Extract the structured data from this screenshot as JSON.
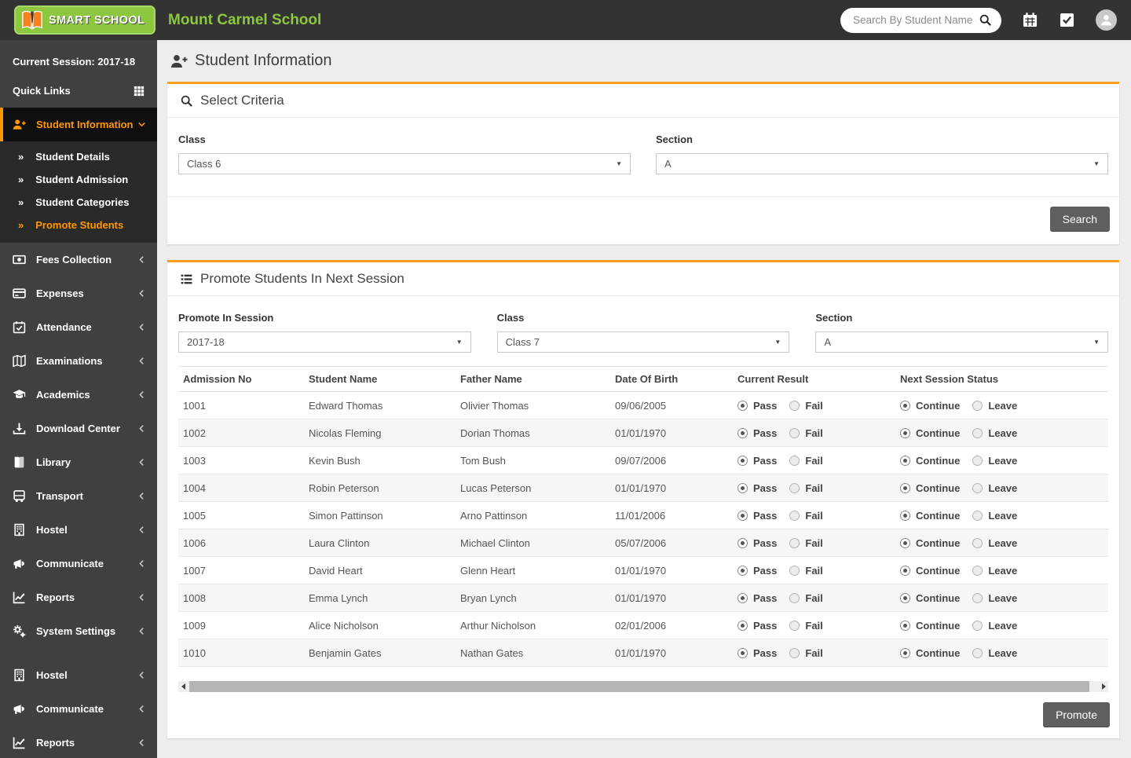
{
  "colors": {
    "accent": "#f9a11b",
    "active_orange": "#ff9800",
    "brand_green": "#8dc63f",
    "button_gray": "#5f5f5f",
    "header_bg": "#333333",
    "sidebar_bg": "#404040"
  },
  "header": {
    "brand": "SMART SCHOOL",
    "school_name": "Mount Carmel School",
    "search_placeholder": "Search By Student Name",
    "icons": [
      "search-icon",
      "calendar-icon",
      "tasks-icon",
      "user-avatar"
    ]
  },
  "sidebar": {
    "session_label": "Current Session: 2017-18",
    "quick_links_label": "Quick Links",
    "quick_links_icon": "grid",
    "active_group": {
      "label": "Student Information",
      "icon": "person-plus",
      "children": [
        {
          "label": "Student Details"
        },
        {
          "label": "Student Admission"
        },
        {
          "label": "Student Categories"
        },
        {
          "label": "Promote Students",
          "active": true
        }
      ]
    },
    "items": [
      {
        "label": "Fees Collection",
        "icon": "money"
      },
      {
        "label": "Expenses",
        "icon": "credit-card"
      },
      {
        "label": "Attendance",
        "icon": "calendar-check"
      },
      {
        "label": "Examinations",
        "icon": "map"
      },
      {
        "label": "Academics",
        "icon": "graduation-cap"
      },
      {
        "label": "Download Center",
        "icon": "download"
      },
      {
        "label": "Library",
        "icon": "book"
      },
      {
        "label": "Transport",
        "icon": "bus"
      },
      {
        "label": "Hostel",
        "icon": "building"
      },
      {
        "label": "Communicate",
        "icon": "megaphone"
      },
      {
        "label": "Reports",
        "icon": "chart"
      },
      {
        "label": "System Settings",
        "icon": "gears"
      },
      {
        "label": "Hostel",
        "icon": "building",
        "spacer_before": true
      },
      {
        "label": "Communicate",
        "icon": "megaphone"
      },
      {
        "label": "Reports",
        "icon": "chart"
      }
    ]
  },
  "page": {
    "title": "Student Information",
    "title_icon": "person-plus"
  },
  "select_criteria": {
    "title": "Select Criteria",
    "title_icon": "search",
    "fields": [
      {
        "label": "Class",
        "value": "Class 6"
      },
      {
        "label": "Section",
        "value": "A"
      }
    ],
    "search_button": "Search"
  },
  "promote_panel": {
    "title": "Promote Students In Next Session",
    "title_icon": "list",
    "fields": [
      {
        "label": "Promote In Session",
        "value": "2017-18"
      },
      {
        "label": "Class",
        "value": "Class 7"
      },
      {
        "label": "Section",
        "value": "A"
      }
    ],
    "table": {
      "columns": [
        "Admission No",
        "Student Name",
        "Father Name",
        "Date Of Birth",
        "Current Result",
        "Next Session Status"
      ],
      "result_options": [
        "Pass",
        "Fail"
      ],
      "status_options": [
        "Continue",
        "Leave"
      ],
      "rows": [
        {
          "admission_no": "1001",
          "student_name": "Edward Thomas",
          "father_name": "Olivier Thomas",
          "dob": "09/06/2005",
          "result": "Pass",
          "status": "Continue"
        },
        {
          "admission_no": "1002",
          "student_name": "Nicolas Fleming",
          "father_name": "Dorian Thomas",
          "dob": "01/01/1970",
          "result": "Pass",
          "status": "Continue"
        },
        {
          "admission_no": "1003",
          "student_name": "Kevin Bush",
          "father_name": "Tom Bush",
          "dob": "09/07/2006",
          "result": "Pass",
          "status": "Continue"
        },
        {
          "admission_no": "1004",
          "student_name": "Robin Peterson",
          "father_name": "Lucas Peterson",
          "dob": "01/01/1970",
          "result": "Pass",
          "status": "Continue"
        },
        {
          "admission_no": "1005",
          "student_name": "Simon Pattinson",
          "father_name": "Arno Pattinson",
          "dob": "11/01/2006",
          "result": "Pass",
          "status": "Continue"
        },
        {
          "admission_no": "1006",
          "student_name": "Laura Clinton",
          "father_name": "Michael Clinton",
          "dob": "05/07/2006",
          "result": "Pass",
          "status": "Continue"
        },
        {
          "admission_no": "1007",
          "student_name": "David Heart",
          "father_name": "Glenn Heart",
          "dob": "01/01/1970",
          "result": "Pass",
          "status": "Continue"
        },
        {
          "admission_no": "1008",
          "student_name": "Emma Lynch",
          "father_name": "Bryan Lynch",
          "dob": "01/01/1970",
          "result": "Pass",
          "status": "Continue"
        },
        {
          "admission_no": "1009",
          "student_name": "Alice Nicholson",
          "father_name": "Arthur Nicholson",
          "dob": "02/01/2006",
          "result": "Pass",
          "status": "Continue"
        },
        {
          "admission_no": "1010",
          "student_name": "Benjamin Gates",
          "father_name": "Nathan Gates",
          "dob": "01/01/1970",
          "result": "Pass",
          "status": "Continue"
        }
      ]
    },
    "promote_button": "Promote"
  }
}
